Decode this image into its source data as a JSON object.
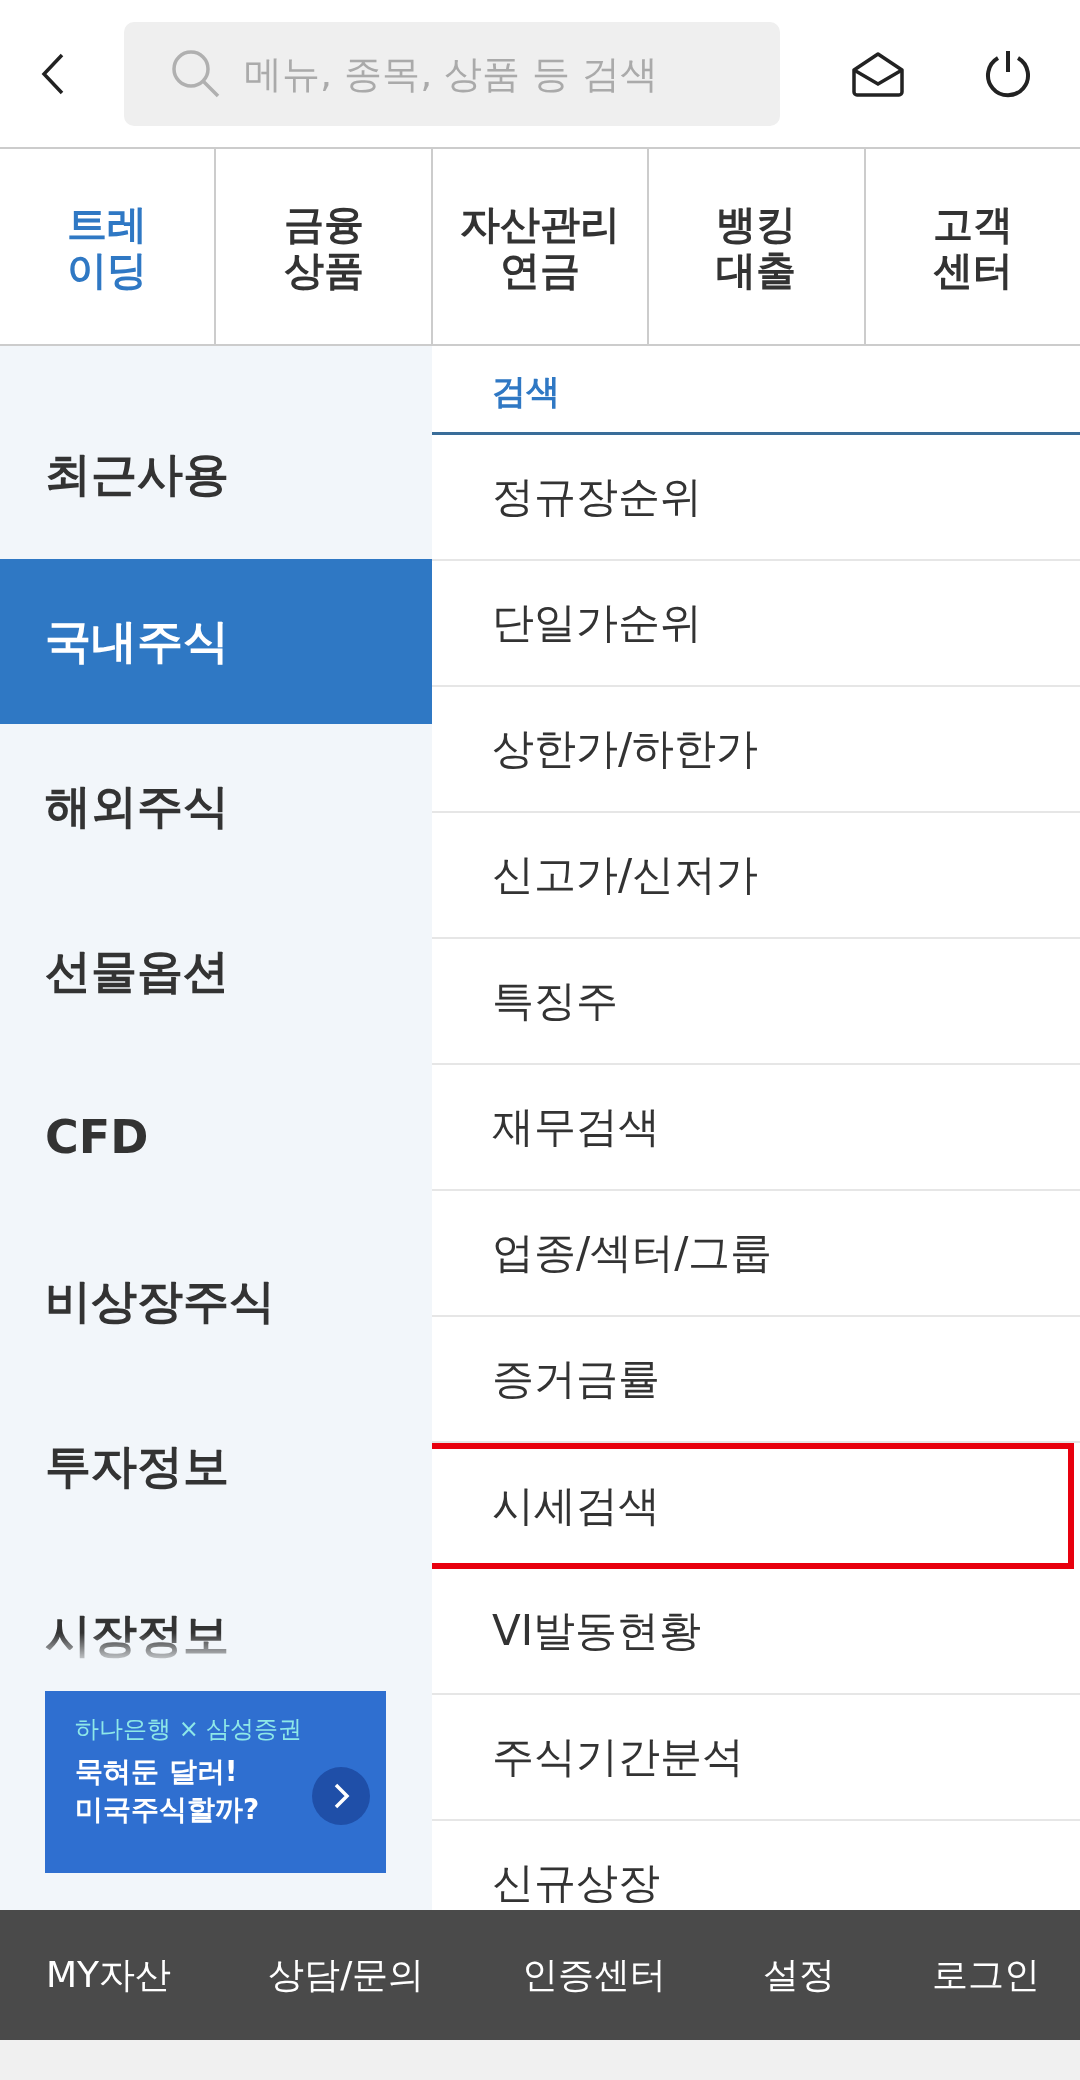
{
  "search": {
    "placeholder": "메뉴, 종목, 상품 등 검색"
  },
  "tabs": [
    {
      "label": "트레\n이딩",
      "selected": true
    },
    {
      "label": "금융\n상품",
      "selected": false
    },
    {
      "label": "자산관리\n연금",
      "selected": false
    },
    {
      "label": "뱅킹\n대출",
      "selected": false
    },
    {
      "label": "고객\n센터",
      "selected": false
    }
  ],
  "sidebar": {
    "items": [
      {
        "label": "최근사용",
        "selected": false
      },
      {
        "label": "국내주식",
        "selected": true
      },
      {
        "label": "해외주식",
        "selected": false
      },
      {
        "label": "선물옵션",
        "selected": false
      },
      {
        "label": "CFD",
        "selected": false
      },
      {
        "label": "비상장주식",
        "selected": false
      },
      {
        "label": "투자정보",
        "selected": false
      },
      {
        "label": "시장정보",
        "selected": false
      }
    ],
    "banner": {
      "tagline": "하나은행 × 삼성증권",
      "headline": "묵혀둔 달러!\n미국주식할까?"
    }
  },
  "menu": {
    "section": "검색",
    "items": [
      {
        "label": "정규장순위",
        "highlighted": false
      },
      {
        "label": "단일가순위",
        "highlighted": false
      },
      {
        "label": "상한가/하한가",
        "highlighted": false
      },
      {
        "label": "신고가/신저가",
        "highlighted": false
      },
      {
        "label": "특징주",
        "highlighted": false
      },
      {
        "label": "재무검색",
        "highlighted": false
      },
      {
        "label": "업종/섹터/그룹",
        "highlighted": false
      },
      {
        "label": "증거금률",
        "highlighted": false
      },
      {
        "label": "시세검색",
        "highlighted": true
      },
      {
        "label": "VI발동현황",
        "highlighted": false
      },
      {
        "label": "주식기간분석",
        "highlighted": false
      },
      {
        "label": "신규상장",
        "highlighted": false
      }
    ]
  },
  "bottom_bar": [
    "MY자산",
    "상담/문의",
    "인증센터",
    "설정",
    "로그인"
  ]
}
